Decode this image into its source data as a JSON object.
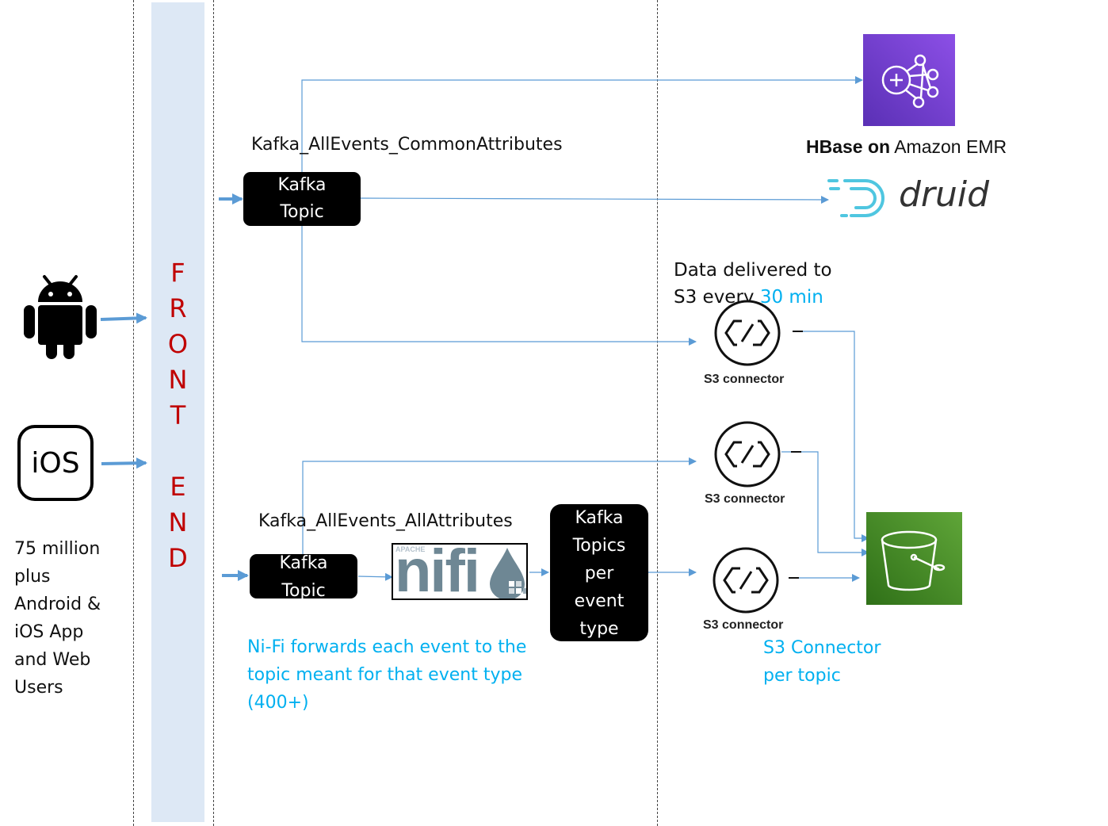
{
  "frontend": {
    "letters_top": [
      "F",
      "R",
      "O",
      "N",
      "T"
    ],
    "letters_bottom": [
      "E",
      "N",
      "D"
    ],
    "bar_color": "#dde8f5",
    "text_color": "#c00000"
  },
  "clients": {
    "android_icon": "android-icon",
    "ios_icon_text": "iOS",
    "description_lines": [
      "75 million",
      "plus",
      "Android &",
      "iOS App",
      "and Web",
      "Users"
    ]
  },
  "topics": {
    "common": {
      "title": "Kafka_AllEvents_CommonAttributes",
      "box_lines": [
        "Kafka",
        "Topic"
      ]
    },
    "all": {
      "title": "Kafka_AllEvents_AllAttributes",
      "box_lines": [
        "Kafka",
        "Topic"
      ]
    },
    "per_event": {
      "box_lines": [
        "Kafka",
        "Topics",
        "per",
        "event",
        "type"
      ]
    }
  },
  "nifi": {
    "apache_label": "APACHE",
    "name": "nifi",
    "note_lines": [
      "Ni-Fi forwards each event to the",
      "topic meant for that event type",
      "(400+)"
    ]
  },
  "hbase": {
    "label_bold": "HBase on",
    "label_rest": " Amazon EMR",
    "tile_color": "#7b3fd6"
  },
  "druid": {
    "name": "druid",
    "accent_color": "#4fc6e0"
  },
  "s3_delivery_note": {
    "line1": "Data delivered to",
    "line2_prefix": "S3 every ",
    "line2_highlight": "30 min"
  },
  "s3_connectors": [
    {
      "label": "S3 connector"
    },
    {
      "label": "S3 connector"
    },
    {
      "label": "S3 connector"
    }
  ],
  "s3_connector_note_lines": [
    "S3 Connector",
    "per topic"
  ],
  "s3_bucket": {
    "tile_color": "#3f8624"
  },
  "colors": {
    "arrow": "#5b9bd5",
    "note": "#00b0f0"
  }
}
